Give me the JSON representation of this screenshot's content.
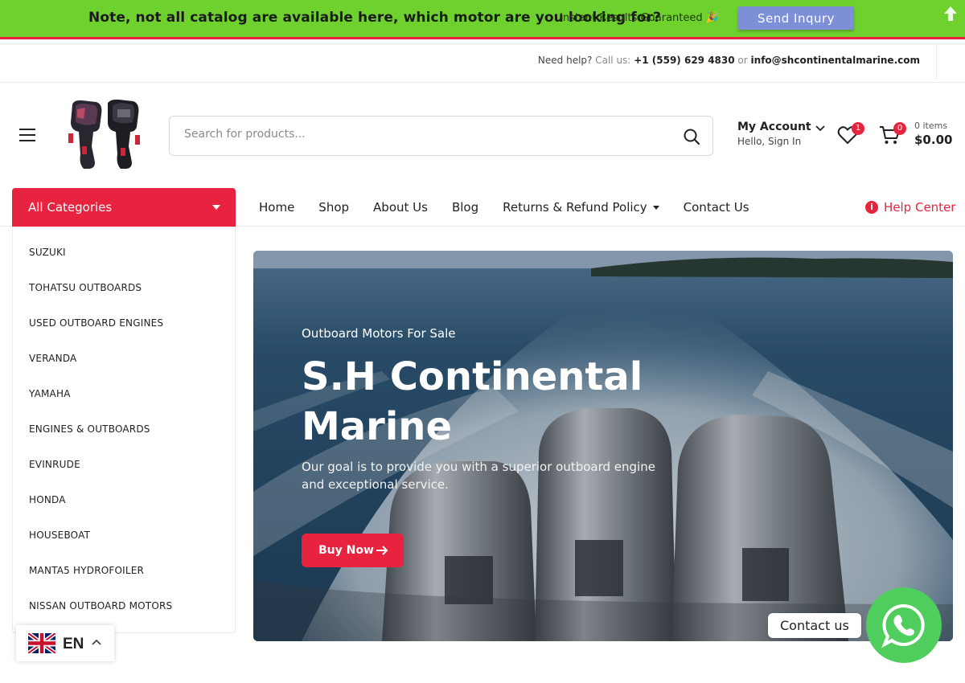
{
  "notice": {
    "text": "Note, not all catalog are available here, which motor are you looking for?",
    "sub": "Instant Results Guaranteed 🎉",
    "button": "Send Inqury",
    "bg_color": "#6fd12e"
  },
  "topbar": {
    "need_help": "Need help?",
    "call_us": "Call us:",
    "phone": "+1 (559) 629 4830",
    "or": "or",
    "email": "info@shcontinentalmarine.com"
  },
  "header": {
    "search_placeholder": "Search for products...",
    "account_title": "My Account",
    "account_sub": "Hello, Sign In",
    "wishlist_count": "1",
    "cart_count": "0",
    "cart_items": "0 items",
    "cart_total": "$0.00"
  },
  "nav": {
    "all_categories": "All Categories",
    "items": [
      "Home",
      "Shop",
      "About Us",
      "Blog",
      "Returns & Refund Policy",
      "Contact Us"
    ],
    "help": "Help Center"
  },
  "categories": [
    "SUZUKI",
    "TOHATSU OUTBOARDS",
    "USED OUTBOARD ENGINES",
    "VERANDA",
    "YAMAHA",
    "ENGINES & OUTBOARDS",
    "EVINRUDE",
    "HONDA",
    "HOUSEBOAT",
    "MANTA5 HYDROFOILER",
    "NISSAN OUTBOARD MOTORS"
  ],
  "hero": {
    "kicker": "Outboard Motors For Sale",
    "title": "S.H Continental Marine",
    "description": "Our goal is to provide you with a superior outboard engine and exceptional service.",
    "button": "Buy Now"
  },
  "language": {
    "code": "EN"
  },
  "whatsapp": {
    "tooltip": "Contact us"
  },
  "colors": {
    "accent": "#e8233f",
    "whatsapp": "#4fce5d"
  }
}
